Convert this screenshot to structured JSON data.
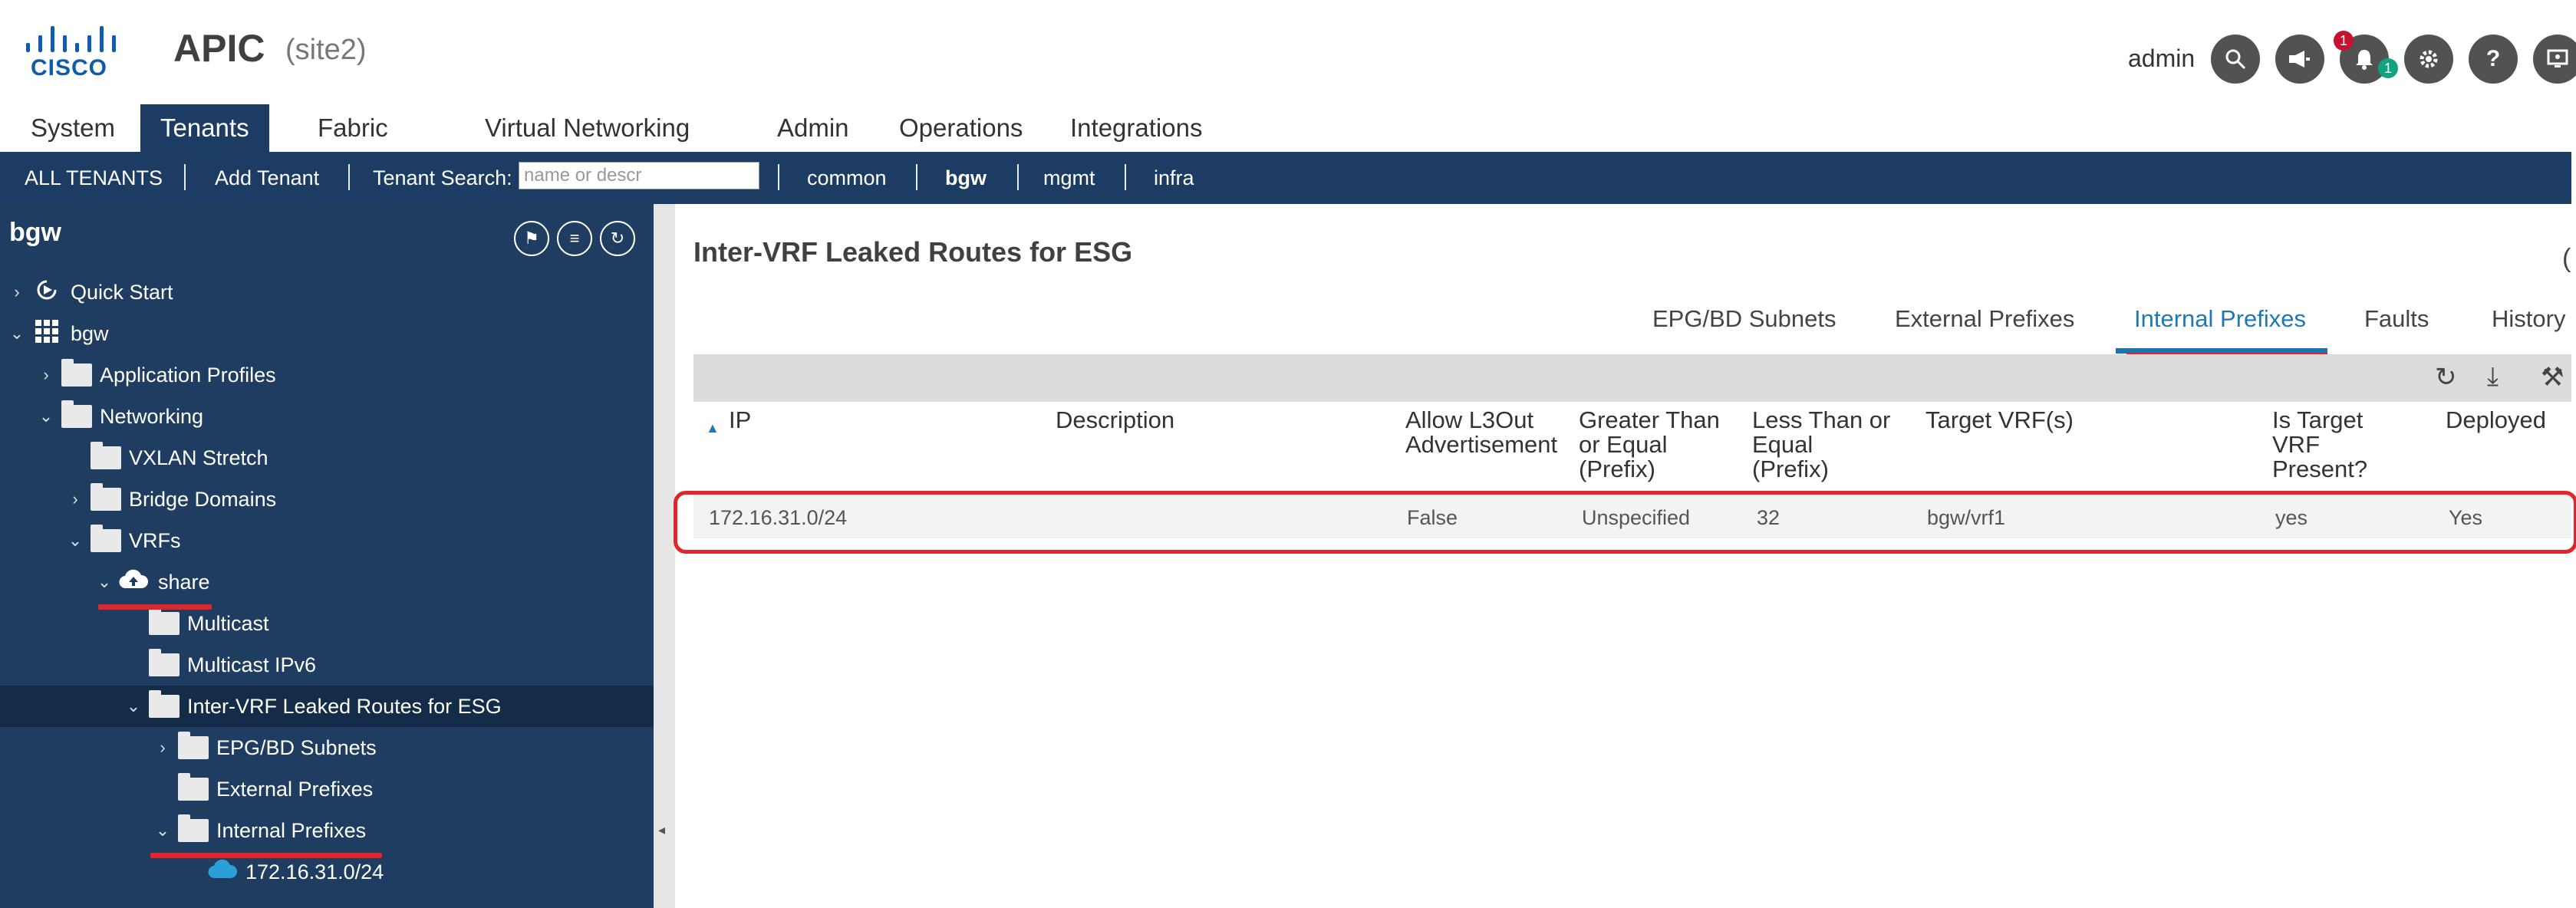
{
  "header": {
    "logo_text": "CISCO",
    "app_title": "APIC",
    "site": "(site2)",
    "user": "admin",
    "notifications_count": "1",
    "alerts_count": "1",
    "icons": [
      "search-icon",
      "announcement-icon",
      "bell-icon",
      "gear-icon",
      "help-icon",
      "display-icon"
    ]
  },
  "nav": {
    "tabs": [
      "System",
      "Tenants",
      "Fabric",
      "Virtual Networking",
      "Admin",
      "Operations",
      "Integrations"
    ],
    "active": "Tenants"
  },
  "subbar": {
    "all_tenants": "ALL TENANTS",
    "add_tenant": "Add Tenant",
    "search_label": "Tenant Search:",
    "search_placeholder": "name or descr",
    "tenants": [
      "common",
      "bgw",
      "mgmt",
      "infra"
    ],
    "active_tenant": "bgw"
  },
  "sidebar": {
    "title": "bgw",
    "tree": [
      {
        "label": "Quick Start",
        "icon": "quick-start-icon"
      },
      {
        "label": "bgw",
        "icon": "tenant-grid-icon"
      },
      {
        "label": "Application Profiles",
        "icon": "folder-icon"
      },
      {
        "label": "Networking",
        "icon": "folder-icon"
      },
      {
        "label": "VXLAN Stretch",
        "icon": "folder-icon"
      },
      {
        "label": "Bridge Domains",
        "icon": "folder-icon"
      },
      {
        "label": "VRFs",
        "icon": "folder-icon"
      },
      {
        "label": "share",
        "icon": "cloud-upload-icon"
      },
      {
        "label": "Multicast",
        "icon": "folder-icon"
      },
      {
        "label": "Multicast IPv6",
        "icon": "folder-icon"
      },
      {
        "label": "Inter-VRF Leaked Routes for ESG",
        "icon": "folder-icon"
      },
      {
        "label": "EPG/BD Subnets",
        "icon": "folder-icon"
      },
      {
        "label": "External Prefixes",
        "icon": "folder-icon"
      },
      {
        "label": "Internal Prefixes",
        "icon": "folder-icon"
      },
      {
        "label": "172.16.31.0/24",
        "icon": "cloud-icon"
      }
    ]
  },
  "main": {
    "title": "Inter-VRF Leaked Routes for ESG",
    "tabs": [
      "EPG/BD Subnets",
      "External Prefixes",
      "Internal Prefixes",
      "Faults",
      "History"
    ],
    "active_tab": "Internal Prefixes",
    "table": {
      "sort_indicator": "▲",
      "columns": [
        "IP",
        "Description",
        "Allow L3Out\nAdvertisement",
        "Greater Than\nor Equal\n(Prefix)",
        "Less Than or\nEqual\n(Prefix)",
        "Target VRF(s)",
        "Is Target\nVRF\nPresent?",
        "Deployed"
      ],
      "rows": [
        [
          "172.16.31.0/24",
          "",
          "False",
          "Unspecified",
          "32",
          "bgw/vrf1",
          "yes",
          "Yes"
        ]
      ]
    }
  },
  "colors": {
    "nav_bg": "#1c3c63",
    "sidebar_bg": "#1e3d60",
    "accent_blue": "#1b74ae",
    "highlight_red": "#e0262b"
  }
}
